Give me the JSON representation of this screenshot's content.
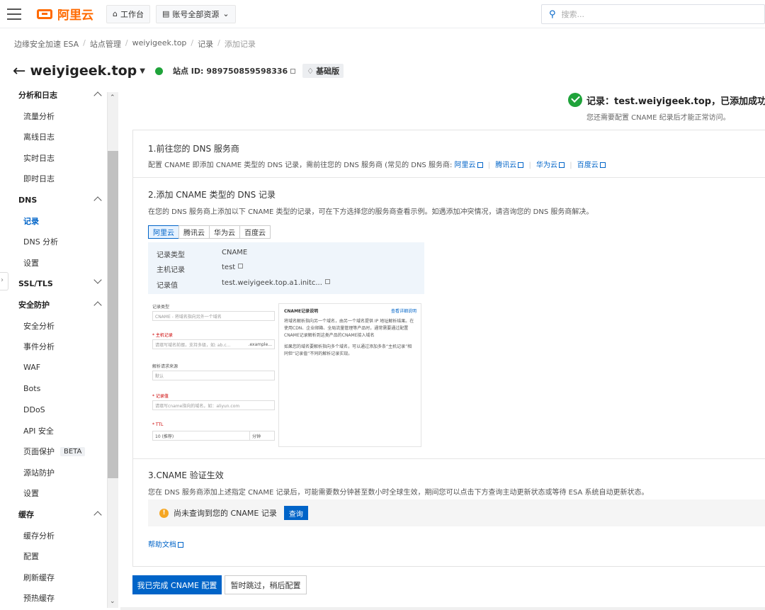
{
  "topbar": {
    "logo": "阿里云",
    "workbench": "工作台",
    "resources": "账号全部资源",
    "search_placeholder": "搜索..."
  },
  "breadcrumb": [
    "边缘安全加速 ESA",
    "站点管理",
    "weiyigeek.top",
    "记录",
    "添加记录"
  ],
  "site": {
    "name": "weiyigeek.top",
    "id_label": "站点 ID:",
    "id": "989750859598336",
    "plan": "基础版"
  },
  "sidebar": [
    {
      "label": "分析和日志",
      "type": "group",
      "caret": "up"
    },
    {
      "label": "流量分析",
      "type": "sub"
    },
    {
      "label": "离线日志",
      "type": "sub"
    },
    {
      "label": "实时日志",
      "type": "sub"
    },
    {
      "label": "即时日志",
      "type": "sub"
    },
    {
      "label": "DNS",
      "type": "group",
      "caret": "up"
    },
    {
      "label": "记录",
      "type": "sub",
      "active": true
    },
    {
      "label": "DNS 分析",
      "type": "sub"
    },
    {
      "label": "设置",
      "type": "sub"
    },
    {
      "label": "SSL/TLS",
      "type": "group",
      "caret": "down"
    },
    {
      "label": "安全防护",
      "type": "group",
      "caret": "up"
    },
    {
      "label": "安全分析",
      "type": "sub"
    },
    {
      "label": "事件分析",
      "type": "sub"
    },
    {
      "label": "WAF",
      "type": "sub"
    },
    {
      "label": "Bots",
      "type": "sub"
    },
    {
      "label": "DDoS",
      "type": "sub"
    },
    {
      "label": "API 安全",
      "type": "sub"
    },
    {
      "label": "页面保护",
      "type": "sub",
      "badge": "BETA"
    },
    {
      "label": "源站防护",
      "type": "sub"
    },
    {
      "label": "设置",
      "type": "sub"
    },
    {
      "label": "缓存",
      "type": "group",
      "caret": "up"
    },
    {
      "label": "缓存分析",
      "type": "sub"
    },
    {
      "label": "配置",
      "type": "sub"
    },
    {
      "label": "刷新缓存",
      "type": "sub"
    },
    {
      "label": "预热缓存",
      "type": "sub"
    }
  ],
  "success": {
    "title": "记录：test.weiyigeek.top，已添加成功!",
    "sub": "您还需要配置 CNAME 纪录后才能正常访问。"
  },
  "step1": {
    "title": "1.前往您的 DNS 服务商",
    "desc": "配置 CNAME 即添加 CNAME 类型的 DNS 记录，需前往您的 DNS 服务商 (常见的 DNS 服务商:",
    "links": [
      "阿里云",
      "腾讯云",
      "华为云",
      "百度云"
    ]
  },
  "step2": {
    "title": "2.添加 CNAME 类型的 DNS 记录",
    "desc": "在您的 DNS 服务商上添加以下 CNAME 类型的记录，可在下方选择您的服务商查看示例。如遇添加冲突情况，请咨询您的 DNS 服务商解决。",
    "tabs": [
      "阿里云",
      "腾讯云",
      "华为云",
      "百度云"
    ],
    "rows": [
      {
        "k": "记录类型",
        "v": "CNAME"
      },
      {
        "k": "主机记录",
        "v": "test"
      },
      {
        "k": "记录值",
        "v": "test.weiyigeek.top.a1.initc..."
      }
    ],
    "form": {
      "type_label": "记录类型",
      "type_value": "CNAME - 将域名指向另外一个域名",
      "host_label": "* 主机记录",
      "host_ph": "请填写域名前缀，支持多级，如: ab.c...",
      "host_suffix": ".example...",
      "source_label": "解析请求来源",
      "source_value": "默认",
      "value_label": "* 记录值",
      "value_ph": "请填写cname指向的域名，如：aliyun.com",
      "ttl_label": "* TTL",
      "ttl_value": "10 (推荐)",
      "ttl_unit": "分钟",
      "note_title": "CNAME记录说明",
      "note_link": "查看详细说明",
      "note_p1": "将域名解析指向另一个域名，由另一个域名提供 IP 地址解析结果。在使用CDN、企业邮箱、全局流量管理等产品时，通常需要通过配置CNAME记录解析到这类产品的CNAME接入域名",
      "note_p2": "如果您的域名要解析指向多个域名，可以通过添加多条“主机记录”相同但“记录值”不同的解析记录实现。"
    }
  },
  "step3": {
    "title": "3.CNAME 验证生效",
    "desc": "您在 DNS 服务商添加上述指定 CNAME 记录后，可能需要数分钟甚至数小时全球生效，期间您可以点击下方查询主动更新状态或等待 ESA 系统自动更新状态。",
    "status": "尚未查询到您的 CNAME 记录",
    "query": "查询",
    "help": "帮助文档"
  },
  "actions": {
    "done": "我已完成 CNAME 配置",
    "skip": "暂时跳过，稍后配置"
  }
}
